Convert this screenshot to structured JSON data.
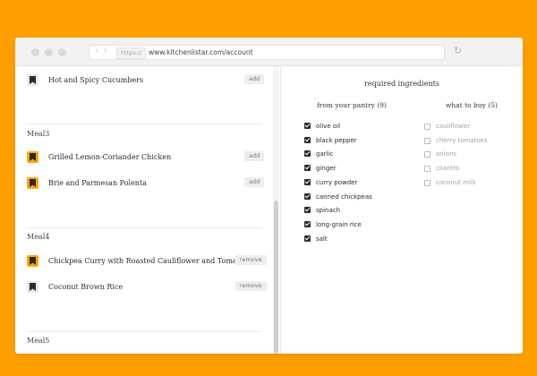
{
  "browser": {
    "protocol": "https://",
    "address": "www.kitchenlistar.com/account",
    "back_arrow": "‹",
    "forward_arrow": "›",
    "reload_glyph": "↻"
  },
  "meals": {
    "first_recipe": {
      "name": "Hot and Spicy Cucumbers",
      "button": "add",
      "bookmarked": false
    },
    "meal3": {
      "label": "Meal3",
      "recipes": [
        {
          "name": "Grilled Lemon-Coriander Chicken",
          "button": "add",
          "bookmarked": true
        },
        {
          "name": "Brie and Parmesan Polenta",
          "button": "add",
          "bookmarked": true
        }
      ]
    },
    "meal4": {
      "label": "Meal4",
      "recipes": [
        {
          "name": "Chickpea Curry with Roasted Cauliflower and Tomatoes",
          "button": "remove",
          "bookmarked": true
        },
        {
          "name": "Coconut Brown Rice",
          "button": "remove",
          "bookmarked": false
        }
      ]
    },
    "meal5": {
      "label": "Meal5"
    }
  },
  "ingredients": {
    "title": "required ingredients",
    "pantry_header": "from your pantry (9)",
    "buy_header": "what to buy (5)",
    "pantry": [
      "olive oil",
      "black pepper",
      "garlic",
      "ginger",
      "curry powder",
      "canned chickpeas",
      "spinach",
      "long-grain rice",
      "salt"
    ],
    "buy": [
      "cauliflower",
      "cherry tomatoes",
      "onions",
      "cilantro",
      "coconut milk"
    ]
  },
  "colors": {
    "background": "#FF9F00",
    "bookmark_active": "#FFA512",
    "bookmark_inactive": "#E9E9E9"
  }
}
